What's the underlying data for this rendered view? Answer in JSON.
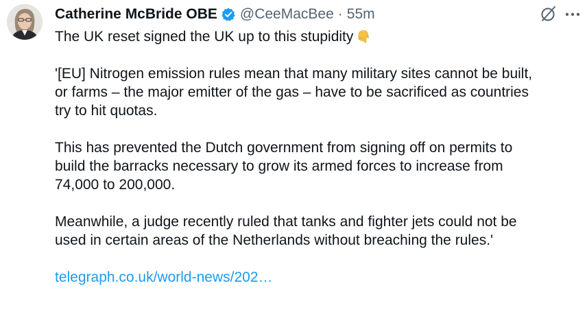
{
  "author": {
    "display_name": "Catherine McBride OBE",
    "handle": "@CeeMacBee",
    "separator": "·",
    "time": "55m",
    "verified": true
  },
  "tweet": {
    "line1": "The UK reset signed the UK up to this stupidity",
    "line1_emoji": "backhand-index-pointing-down",
    "para2": "'[EU] Nitrogen emission rules mean that many military sites cannot be built,\nor farms – the major emitter of the gas – have to be sacrificed as countries\ntry to hit quotas.",
    "para3": "This has prevented the Dutch government from signing off on permits to\nbuild the barracks necessary to grow its armed forces to increase from\n74,000 to 200,000.",
    "para4": "Meanwhile, a judge recently ruled that tanks and fighter jets could not be\nused in certain areas of the Netherlands without breaching the rules.'",
    "link_text": "telegraph.co.uk/world-news/202…"
  },
  "colors": {
    "text": "#0f1419",
    "secondary": "#536471",
    "link": "#1d9bf0",
    "verified": "#1d9bf0"
  },
  "icons": {
    "verified": "verified-badge-icon",
    "grok": "grok-icon",
    "more": "more-icon"
  }
}
